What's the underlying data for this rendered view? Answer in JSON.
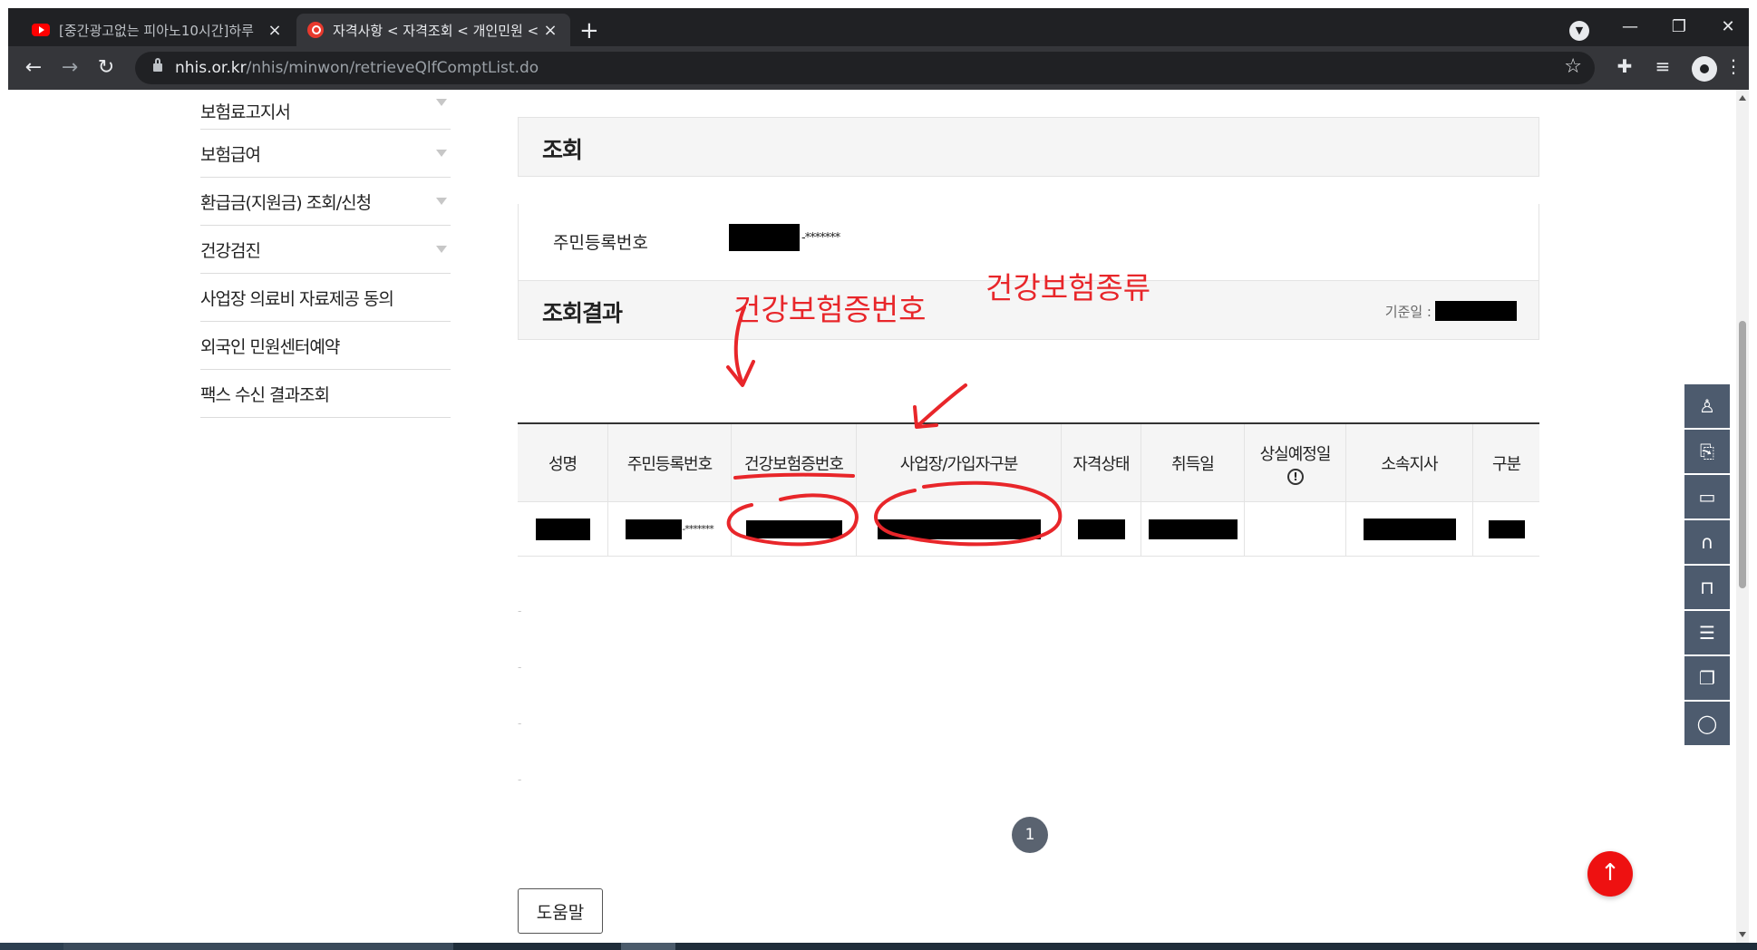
{
  "browser": {
    "tabs": [
      {
        "title": "[중간광고없는 피아노10시간]하루",
        "active": false
      },
      {
        "title": "자격사항 < 자격조회 < 개인민원 <",
        "active": true
      }
    ],
    "new_tab": "+",
    "url_host": "nhis.or.kr",
    "url_path": "/nhis/minwon/retrieveQlfComptList.do",
    "window_controls": {
      "minimize": "—",
      "restore": "❐",
      "close": "✕"
    }
  },
  "sidebar": {
    "items": [
      {
        "label": "보험료고지서",
        "has_arrow": true
      },
      {
        "label": "보험급여",
        "has_arrow": true
      },
      {
        "label": "환급금(지원금) 조회/신청",
        "has_arrow": true
      },
      {
        "label": "건강검진",
        "has_arrow": true
      },
      {
        "label": "사업장 의료비 자료제공 동의",
        "has_arrow": false
      },
      {
        "label": "외국인 민원센터예약",
        "has_arrow": false
      },
      {
        "label": "팩스 수신 결과조회",
        "has_arrow": false
      }
    ]
  },
  "query": {
    "title": "조회",
    "rrn_label": "주민등록번호",
    "rrn_masked": "-*******"
  },
  "results": {
    "title": "조회결과",
    "base_date_label": "기준일 :",
    "columns": [
      "성명",
      "주민등록번호",
      "건강보험증번호",
      "사업장/가입자구분",
      "자격상태",
      "취득일",
      "상실예정일",
      "소속지사",
      "구분"
    ],
    "row_masked_rrn": "-*******"
  },
  "annotations": {
    "card_number_label": "건강보험증번호",
    "insurance_type_label": "건강보험종류",
    "color": "#e8262a"
  },
  "pagination": {
    "current": "1"
  },
  "help_button": "도움말",
  "quick_menu": [
    "person-icon",
    "document-search-icon",
    "monitor-icon",
    "headset-icon",
    "lock-icon",
    "list-icon",
    "windows-icon",
    "chat-icon"
  ],
  "top_button": "↑"
}
